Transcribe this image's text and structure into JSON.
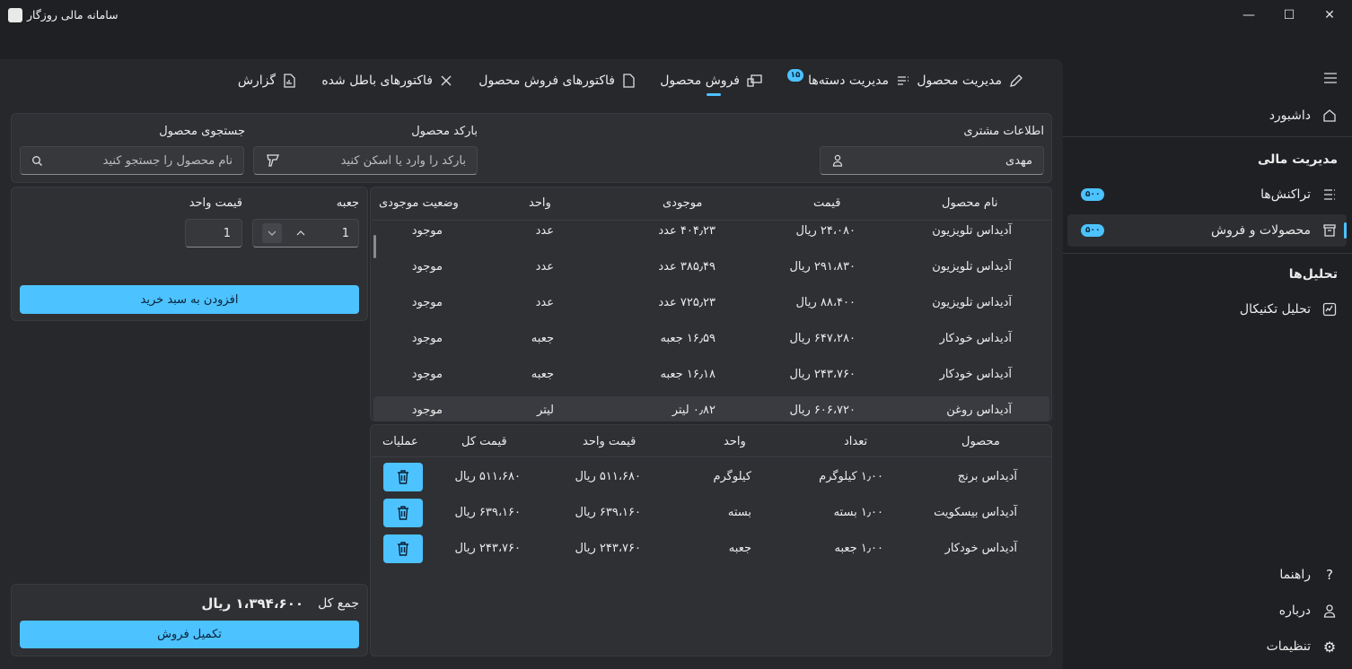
{
  "window": {
    "title": "سامانه مالی روزگار",
    "minimize": "—",
    "maximize": "☐",
    "close": "✕"
  },
  "sidebar": {
    "menu_icon": "hamburger-icon",
    "dashboard": "داشبورد",
    "section_finance": "مدیریت مالی",
    "transactions": "تراکنش‌ها",
    "transactions_badge": "۵۰۰",
    "products_sales": "محصولات و فروش",
    "products_badge": "۵۰۰",
    "section_analysis": "تحلیل‌ها",
    "technical": "تحلیل تکنیکال",
    "help": "راهنما",
    "about": "درباره",
    "settings": "تنظیمات"
  },
  "tabs": {
    "manage_product": "مدیریت محصول",
    "manage_categories": "مدیریت دسته‌ها",
    "categories_badge": "۱۵",
    "sell_product": "فروش محصول",
    "sales_invoices": "فاکتورهای فروش محصول",
    "void_invoices": "فاکتورهای باطل شده",
    "report": "گزارش"
  },
  "search": {
    "customer_label": "اطلاعات مشتری",
    "customer_value": "مهدی",
    "barcode_label": "بارکد محصول",
    "barcode_placeholder": "بارکد را وارد یا اسکن کنید",
    "product_label": "جستجوی محصول",
    "product_placeholder": "نام محصول را جستجو کنید"
  },
  "products_table": {
    "headers": {
      "name": "نام محصول",
      "price": "قیمت",
      "stock": "موجودی",
      "unit": "واحد",
      "status": "وضعیت موجودی"
    },
    "rows": [
      {
        "name": "آدیداس تلویزیون",
        "price": "۲۴،۰۸۰ ریال",
        "stock": "۴۰۴٫۲۳ عدد",
        "unit": "عدد",
        "status": "موجود"
      },
      {
        "name": "آدیداس تلویزیون",
        "price": "۲۹۱،۸۳۰ ریال",
        "stock": "۳۸۵٫۴۹ عدد",
        "unit": "عدد",
        "status": "موجود"
      },
      {
        "name": "آدیداس تلویزیون",
        "price": "۸۸،۴۰۰ ریال",
        "stock": "۷۲۵٫۲۳ عدد",
        "unit": "عدد",
        "status": "موجود"
      },
      {
        "name": "آدیداس خودکار",
        "price": "۶۴۷،۲۸۰ ریال",
        "stock": "۱۶٫۵۹ جعبه",
        "unit": "جعبه",
        "status": "موجود"
      },
      {
        "name": "آدیداس خودکار",
        "price": "۲۴۳،۷۶۰ ریال",
        "stock": "۱۶٫۱۸ جعبه",
        "unit": "جعبه",
        "status": "موجود"
      },
      {
        "name": "آدیداس روغن",
        "price": "۶۰۶،۷۲۰ ریال",
        "stock": "۰٫۸۲ لیتر",
        "unit": "لیتر",
        "status": "موجود"
      }
    ]
  },
  "add_panel": {
    "box_label": "جعبه",
    "box_value": "1",
    "unit_price_label": "قیمت واحد",
    "unit_price_value": "1",
    "add_button": "افزودن به سبد خرید"
  },
  "cart_table": {
    "headers": {
      "product": "محصول",
      "qty": "تعداد",
      "unit": "واحد",
      "unit_price": "قیمت واحد",
      "total": "قیمت کل",
      "actions": "عملیات"
    },
    "rows": [
      {
        "product": "آدیداس برنج",
        "qty": "۱٫۰۰ کیلوگرم",
        "unit": "کیلوگرم",
        "unit_price": "۵۱۱،۶۸۰ ریال",
        "total": "۵۱۱،۶۸۰ ریال"
      },
      {
        "product": "آدیداس بیسکویت",
        "qty": "۱٫۰۰ بسته",
        "unit": "بسته",
        "unit_price": "۶۳۹،۱۶۰ ریال",
        "total": "۶۳۹،۱۶۰ ریال"
      },
      {
        "product": "آدیداس خودکار",
        "qty": "۱٫۰۰ جعبه",
        "unit": "جعبه",
        "unit_price": "۲۴۳،۷۶۰ ریال",
        "total": "۲۴۳،۷۶۰ ریال"
      }
    ]
  },
  "summary": {
    "total_label": "جمع کل",
    "total_value": "۱،۳۹۴،۶۰۰ ریال",
    "complete_button": "تکمیل فروش"
  },
  "colors": {
    "accent": "#4cc2ff",
    "background": "#1f2024",
    "card": "#2f3034"
  }
}
